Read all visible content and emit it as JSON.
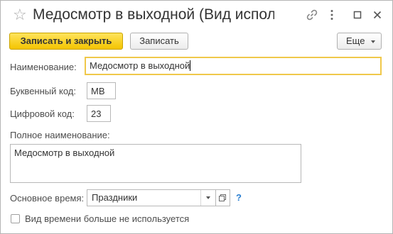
{
  "window": {
    "title": "Медосмотр в выходной (Вид использов...",
    "favorite_icon": "star-icon",
    "link_icon": "link-icon",
    "more_icon": "more-vertical-icon",
    "maximize_icon": "maximize-icon",
    "close_icon": "close-icon"
  },
  "toolbar": {
    "save_close_label": "Записать и закрыть",
    "save_label": "Записать",
    "more_label": "Еще"
  },
  "form": {
    "name_label": "Наименование:",
    "name_value": "Медосмотр в выходной",
    "letter_code_label": "Буквенный код:",
    "letter_code_value": "МВ",
    "digit_code_label": "Цифровой код:",
    "digit_code_value": "23",
    "full_name_label": "Полное наименование:",
    "full_name_value": "Медосмотр в выходной",
    "main_time_label": "Основное время:",
    "main_time_value": "Праздники",
    "help_label": "?",
    "not_used_label": "Вид времени больше не используется",
    "not_used_checked": false
  },
  "colors": {
    "primary_button": "#f4c400",
    "focus_border": "#f0c84a",
    "help": "#2a7fd1"
  }
}
